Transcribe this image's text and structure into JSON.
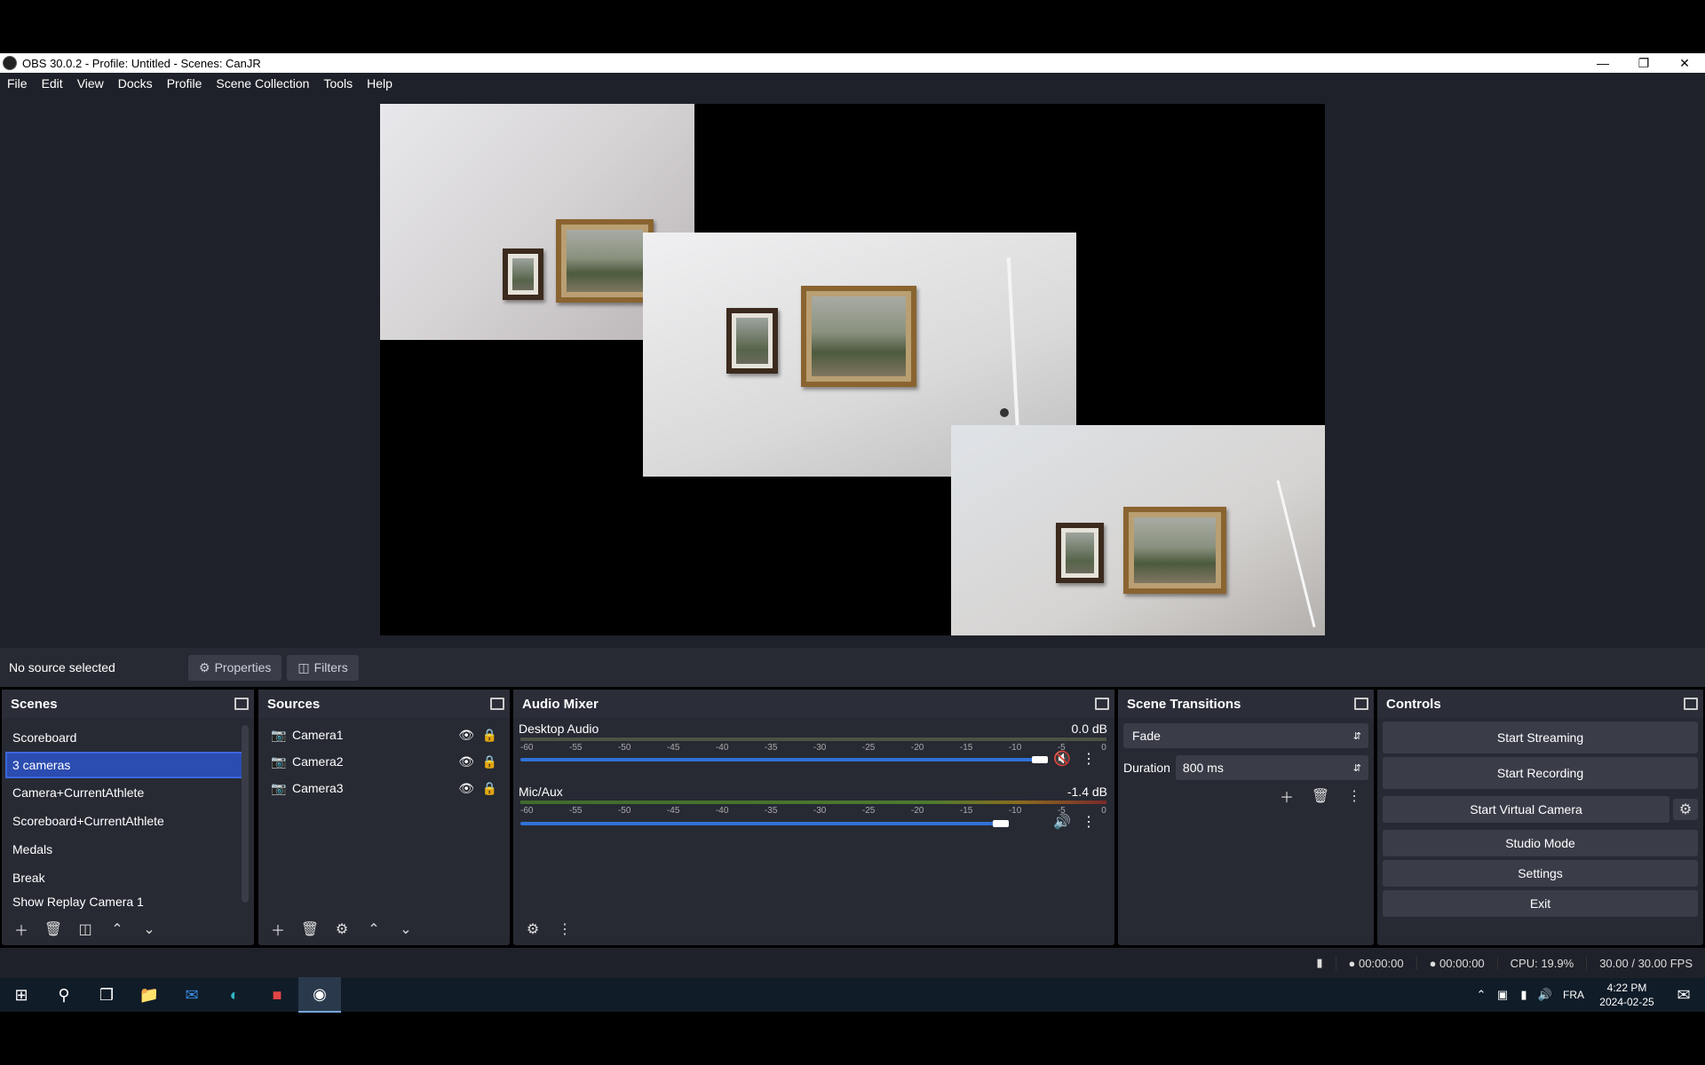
{
  "window": {
    "title": "OBS 30.0.2 - Profile: Untitled - Scenes: CanJR"
  },
  "menu": [
    "File",
    "Edit",
    "View",
    "Docks",
    "Profile",
    "Scene Collection",
    "Tools",
    "Help"
  ],
  "source_bar": {
    "status": "No source selected",
    "properties": "Properties",
    "filters": "Filters"
  },
  "scenes": {
    "title": "Scenes",
    "items": [
      "Scoreboard",
      "3 cameras",
      "Camera+CurrentAthlete",
      "Scoreboard+CurrentAthlete",
      "Medals",
      "Break",
      "Show Replay Camera 1"
    ],
    "selected_index": 1
  },
  "sources": {
    "title": "Sources",
    "items": [
      "Camera1",
      "Camera2",
      "Camera3"
    ]
  },
  "audio_mixer": {
    "title": "Audio Mixer",
    "scale": [
      "-60",
      "-55",
      "-50",
      "-45",
      "-40",
      "-35",
      "-30",
      "-25",
      "-20",
      "-15",
      "-10",
      "-5",
      "0"
    ],
    "tracks": [
      {
        "name": "Desktop Audio",
        "db": "0.0 dB",
        "muted": true,
        "level": 0.88
      },
      {
        "name": "Mic/Aux",
        "db": "-1.4 dB",
        "muted": false,
        "level": 0.82
      }
    ]
  },
  "scene_transitions": {
    "title": "Scene Transitions",
    "transition": "Fade",
    "duration_label": "Duration",
    "duration": "800 ms"
  },
  "controls": {
    "title": "Controls",
    "start_streaming": "Start Streaming",
    "start_recording": "Start Recording",
    "start_virtual_camera": "Start Virtual Camera",
    "studio_mode": "Studio Mode",
    "settings": "Settings",
    "exit": "Exit"
  },
  "status": {
    "stream_time": "00:00:00",
    "record_time": "00:00:00",
    "cpu": "CPU: 19.9%",
    "fps": "30.00 / 30.00 FPS"
  },
  "taskbar": {
    "lang": "FRA",
    "time": "4:22 PM",
    "date": "2024-02-25"
  },
  "colors": {
    "panel": "#272a33",
    "background": "#1f212a",
    "accent": "#3071d6",
    "selection": "#2b4cb0"
  }
}
